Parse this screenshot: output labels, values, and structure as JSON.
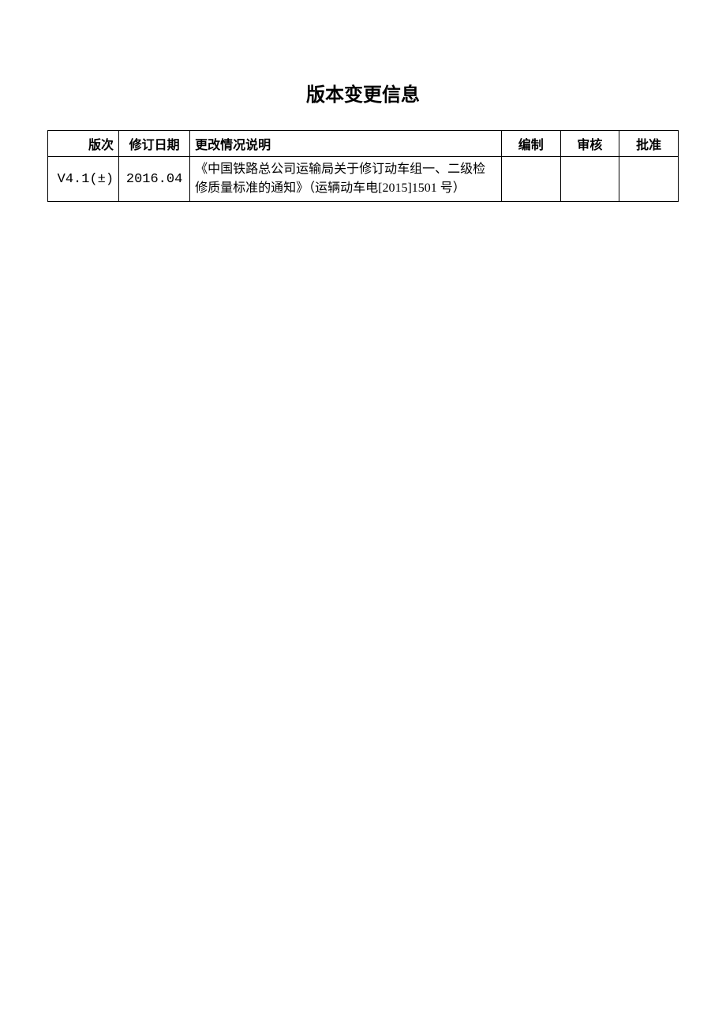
{
  "title": "版本变更信息",
  "table": {
    "headers": {
      "version": "版次",
      "revisionDate": "修订日期",
      "changeDescription": "更改情况说明",
      "compile": "编制",
      "review": "审核",
      "approve": "批准"
    },
    "rows": [
      {
        "version": "V4.1(±)",
        "revisionDate": "2016.04",
        "changeDescription": "《中国铁路总公司运输局关于修订动车组一、二级检修质量标准的通知》（运辆动车电[2015]1501 号）",
        "compile": "",
        "review": "",
        "approve": ""
      }
    ]
  }
}
